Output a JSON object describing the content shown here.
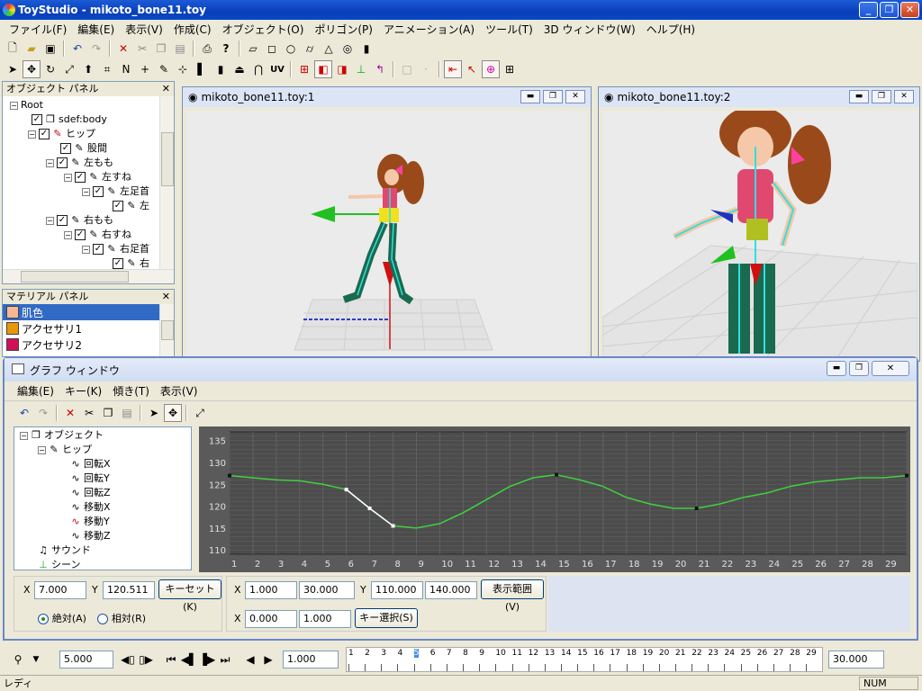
{
  "app": {
    "title": "ToyStudio - mikoto_bone11.toy"
  },
  "menu": [
    "ファイル(F)",
    "編集(E)",
    "表示(V)",
    "作成(C)",
    "オブジェクト(O)",
    "ポリゴン(P)",
    "アニメーション(A)",
    "ツール(T)",
    "3D ウィンドウ(W)",
    "ヘルプ(H)"
  ],
  "object_panel": {
    "title": "オブジェクト パネル",
    "items": [
      "Root",
      "sdef:body",
      "ヒップ",
      "股間",
      "左もも",
      "左すね",
      "左足首",
      "左",
      "右もも",
      "右すね",
      "右足首",
      "右"
    ]
  },
  "material_panel": {
    "title": "マテリアル パネル",
    "items": [
      {
        "name": "肌色",
        "color": "#f4b896"
      },
      {
        "name": "アクセサリ1",
        "color": "#e8960a"
      },
      {
        "name": "アクセサリ2",
        "color": "#d01058"
      }
    ]
  },
  "view1": {
    "title": "mikoto_bone11.toy:1"
  },
  "view2": {
    "title": "mikoto_bone11.toy:2"
  },
  "graph": {
    "title": "グラフ ウィンドウ",
    "menu": [
      "編集(E)",
      "キー(K)",
      "傾き(T)",
      "表示(V)"
    ],
    "tree": [
      "オブジェクト",
      "ヒップ",
      "回転X",
      "回転Y",
      "回転Z",
      "移動X",
      "移動Y",
      "移動Z",
      "サウンド",
      "シーン"
    ],
    "x_label": "X",
    "y_label": "Y",
    "x_value": "7.000",
    "y_value": "120.511",
    "key_set": "キーセット(K)",
    "absolute": "絶対(A)",
    "relative": "相対(R)",
    "range_x_min": "1.000",
    "range_x_max": "30.000",
    "range_y_min": "110.000",
    "range_y_max": "140.000",
    "display_range": "表示範囲(V)",
    "sel_min": "0.000",
    "sel_max": "1.000",
    "key_select": "キー選択(S)"
  },
  "chart_data": {
    "type": "line",
    "x": [
      1,
      2,
      3,
      4,
      5,
      6,
      7,
      8,
      9,
      10,
      11,
      12,
      13,
      14,
      15,
      16,
      17,
      18,
      19,
      20,
      21,
      22,
      23,
      24,
      25,
      26,
      27,
      28,
      29,
      30
    ],
    "values": [
      127,
      126.5,
      126,
      125.8,
      125,
      123.8,
      119.5,
      115.5,
      115,
      116,
      118.5,
      121.5,
      124.5,
      126.5,
      127.2,
      126,
      124.5,
      122,
      120.5,
      119.5,
      119.5,
      120.5,
      122,
      123,
      124.5,
      125.5,
      126,
      126.5,
      126.5,
      127
    ],
    "keys": [
      1,
      6,
      7,
      8,
      15,
      21,
      30
    ],
    "xlim": [
      1,
      30
    ],
    "ylim": [
      109,
      137
    ],
    "yticks": [
      110,
      115,
      120,
      125,
      130,
      135
    ],
    "grid": true
  },
  "timeline": {
    "fps": "5.000",
    "step": "1.000",
    "end": "30.000",
    "frames": [
      "1",
      "2",
      "3",
      "4",
      "5",
      "6",
      "7",
      "8",
      "9",
      "10",
      "11",
      "12",
      "13",
      "14",
      "15",
      "16",
      "17",
      "18",
      "19",
      "20",
      "21",
      "22",
      "23",
      "24",
      "25",
      "26",
      "27",
      "28",
      "29"
    ],
    "current": "5"
  },
  "status": {
    "text": "レディ",
    "num": "NUM"
  }
}
